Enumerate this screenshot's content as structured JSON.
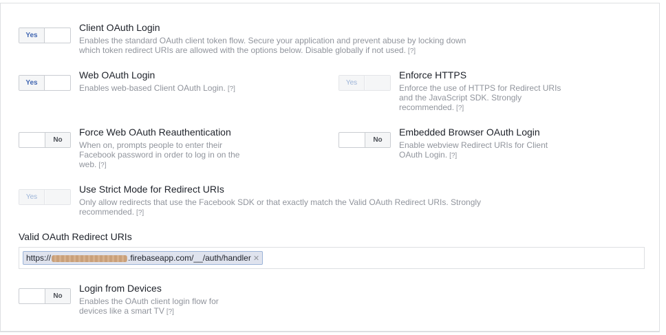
{
  "settings": {
    "client_oauth": {
      "toggle": "Yes",
      "title": "Client OAuth Login",
      "desc": "Enables the standard OAuth client token flow. Secure your application and prevent abuse by locking down which token redirect URIs are allowed with the options below. Disable globally if not used."
    },
    "web_oauth": {
      "toggle": "Yes",
      "title": "Web OAuth Login",
      "desc": "Enables web-based Client OAuth Login."
    },
    "enforce_https": {
      "toggle": "Yes",
      "title": "Enforce HTTPS",
      "desc": "Enforce the use of HTTPS for Redirect URIs and the JavaScript SDK. Strongly recommended."
    },
    "force_reauth": {
      "toggle": "No",
      "title": "Force Web OAuth Reauthentication",
      "desc": "When on, prompts people to enter their Facebook password in order to log in on the web."
    },
    "embedded_browser": {
      "toggle": "No",
      "title": "Embedded Browser OAuth Login",
      "desc": "Enable webview Redirect URIs for Client OAuth Login."
    },
    "strict_mode": {
      "toggle": "Yes",
      "title": "Use Strict Mode for Redirect URIs",
      "desc": "Only allow redirects that use the Facebook SDK or that exactly match the Valid OAuth Redirect URIs. Strongly recommended."
    },
    "login_devices": {
      "toggle": "No",
      "title": "Login from Devices",
      "desc": "Enables the OAuth client login flow for devices like a smart TV"
    }
  },
  "help_label": "[?]",
  "redirect_uris": {
    "label": "Valid OAuth Redirect URIs",
    "token_prefix": "https://",
    "token_suffix": ".firebaseapp.com/__/auth/handler",
    "remove_glyph": "✕"
  },
  "colors": {
    "accent": "#4267b2",
    "text": "#1d2129",
    "muted": "#90949c",
    "border": "#dddfe2"
  }
}
